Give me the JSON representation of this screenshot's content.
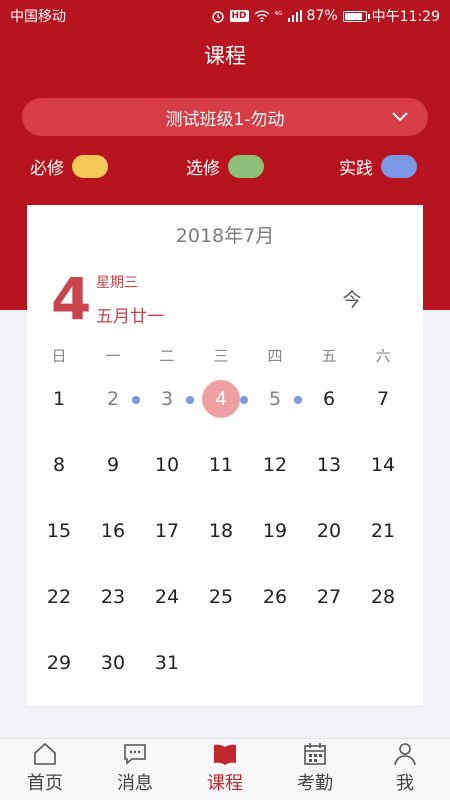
{
  "status_bar": {
    "carrier": "中国移动",
    "hd": "HD",
    "signal": "⁴ᴳ",
    "battery": "87%",
    "battery_level": 0.87,
    "time": "中午11:29"
  },
  "header": {
    "title": "课程"
  },
  "class_select": {
    "value": "测试班级1-勿动"
  },
  "legend": [
    {
      "label": "必修",
      "color": "#f4c957"
    },
    {
      "label": "选修",
      "color": "#8dbf78"
    },
    {
      "label": "实践",
      "color": "#7b97e5"
    }
  ],
  "calendar": {
    "month": "2018年7月",
    "big_day": "4",
    "weekday": "星期三",
    "lunar": "五月廿一",
    "today_button": "今",
    "weekday_headers": [
      "日",
      "一",
      "二",
      "三",
      "四",
      "五",
      "六"
    ],
    "first_weekday_index": 0,
    "days": [
      "1",
      "2",
      "3",
      "4",
      "5",
      "6",
      "7",
      "8",
      "9",
      "10",
      "11",
      "12",
      "13",
      "14",
      "15",
      "16",
      "17",
      "18",
      "19",
      "20",
      "21",
      "22",
      "23",
      "24",
      "25",
      "26",
      "27",
      "28",
      "29",
      "30",
      "31"
    ],
    "selected_day": 4,
    "muted_days": [
      2,
      3,
      5
    ],
    "days_with_courses": [
      2,
      3,
      4,
      5
    ]
  },
  "tabbar": [
    {
      "label": "首页",
      "icon": "home-icon"
    },
    {
      "label": "消息",
      "icon": "message-icon"
    },
    {
      "label": "课程",
      "icon": "book-icon",
      "active": true
    },
    {
      "label": "考勤",
      "icon": "calendar-icon"
    },
    {
      "label": "我",
      "icon": "user-icon"
    }
  ]
}
